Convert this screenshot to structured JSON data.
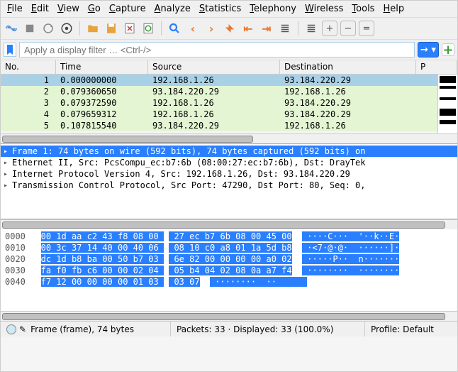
{
  "menu": [
    "File",
    "Edit",
    "View",
    "Go",
    "Capture",
    "Analyze",
    "Statistics",
    "Telephony",
    "Wireless",
    "Tools",
    "Help"
  ],
  "filter": {
    "placeholder": "Apply a display filter … <Ctrl-/>"
  },
  "columns": {
    "no": "No.",
    "time": "Time",
    "source": "Source",
    "destination": "Destination",
    "protocol": "P"
  },
  "packets": [
    {
      "no": "1",
      "time": "0.000000000",
      "src": "192.168.1.26",
      "dst": "93.184.220.29",
      "cls": "sel"
    },
    {
      "no": "2",
      "time": "0.079360650",
      "src": "93.184.220.29",
      "dst": "192.168.1.26",
      "cls": "green"
    },
    {
      "no": "3",
      "time": "0.079372590",
      "src": "192.168.1.26",
      "dst": "93.184.220.29",
      "cls": "green"
    },
    {
      "no": "4",
      "time": "0.079659312",
      "src": "192.168.1.26",
      "dst": "93.184.220.29",
      "cls": "green"
    },
    {
      "no": "5",
      "time": "0.107815540",
      "src": "93.184.220.29",
      "dst": "192.168.1.26",
      "cls": "green"
    }
  ],
  "tree": [
    {
      "sel": true,
      "exp": "▸",
      "text": "Frame 1: 74 bytes on wire (592 bits), 74 bytes captured (592 bits) on"
    },
    {
      "sel": false,
      "exp": "▸",
      "text": "Ethernet II, Src: PcsCompu_ec:b7:6b (08:00:27:ec:b7:6b), Dst: DrayTek"
    },
    {
      "sel": false,
      "exp": "▸",
      "text": "Internet Protocol Version 4, Src: 192.168.1.26, Dst: 93.184.220.29"
    },
    {
      "sel": false,
      "exp": "▸",
      "text": "Transmission Control Protocol, Src Port: 47290, Dst Port: 80, Seq: 0,"
    }
  ],
  "hex": [
    {
      "off": "0000",
      "h1": "00 1d aa c2 43 f8 08 00 ",
      "h2": " 27 ec b7 6b 08 00 45 00",
      "a1": " ····C··· ",
      "a2": " '··k··E·"
    },
    {
      "off": "0010",
      "h1": "00 3c 37 14 40 00 40 06 ",
      "h2": " 08 10 c0 a8 01 1a 5d b8",
      "a1": " ·<7·@·@· ",
      "a2": " ······]·"
    },
    {
      "off": "0020",
      "h1": "dc 1d b8 ba 00 50 b7 03 ",
      "h2": " 6e 82 00 00 00 00 a0 02",
      "a1": " ·····P·· ",
      "a2": " n·······"
    },
    {
      "off": "0030",
      "h1": "fa f0 fb c6 00 00 02 04 ",
      "h2": " 05 b4 04 02 08 0a a7 f4",
      "a1": " ········ ",
      "a2": " ········"
    },
    {
      "off": "0040",
      "h1": "f7 12 00 00 00 00 01 03 ",
      "h2": " 03 07",
      "a1": " ········ ",
      "a2": " ··      "
    }
  ],
  "status": {
    "left": "Frame (frame), 74 bytes",
    "mid": "Packets: 33 · Displayed: 33 (100.0%)",
    "right": "Profile: Default"
  }
}
